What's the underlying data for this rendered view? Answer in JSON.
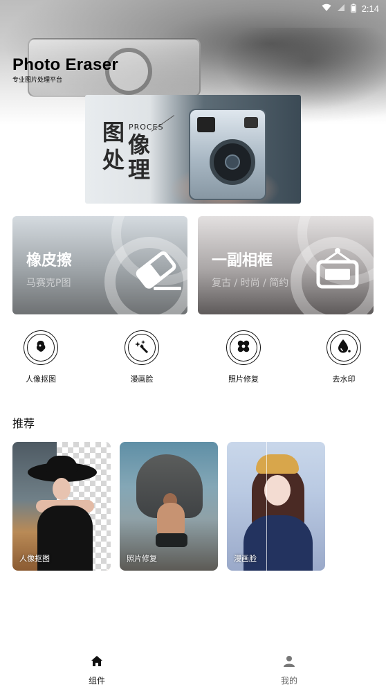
{
  "status_bar": {
    "time": "2:14"
  },
  "header": {
    "title": "Photo Eraser",
    "subtitle": "专业图片处理平台"
  },
  "banner": {
    "chars": [
      "图",
      "处",
      "像",
      "理"
    ],
    "english": "PROCES"
  },
  "feature_cards": [
    {
      "title": "橡皮擦",
      "subtitle": "马赛克P图",
      "icon": "eraser-icon"
    },
    {
      "title": "一副相框",
      "subtitle": "复古 / 时尚 / 简约",
      "icon": "photo-frame-icon"
    }
  ],
  "tools": [
    {
      "label": "人像抠图",
      "icon": "portrait-cutout-icon"
    },
    {
      "label": "漫画脸",
      "icon": "sparkle-wand-icon"
    },
    {
      "label": "照片修复",
      "icon": "bandage-icon"
    },
    {
      "label": "去水印",
      "icon": "water-drop-icon"
    }
  ],
  "recommend": {
    "title": "推荐",
    "items": [
      {
        "label": "人像抠图"
      },
      {
        "label": "照片修复"
      },
      {
        "label": "漫画脸"
      }
    ]
  },
  "bottom_nav": {
    "items": [
      {
        "label": "组件",
        "icon": "home-icon",
        "active": true
      },
      {
        "label": "我的",
        "icon": "user-icon",
        "active": false
      }
    ]
  },
  "colors": {
    "text": "#111111",
    "inactive_nav": "#666666",
    "card_left": "#9ea4a8",
    "card_right": "#a9a5a5"
  }
}
